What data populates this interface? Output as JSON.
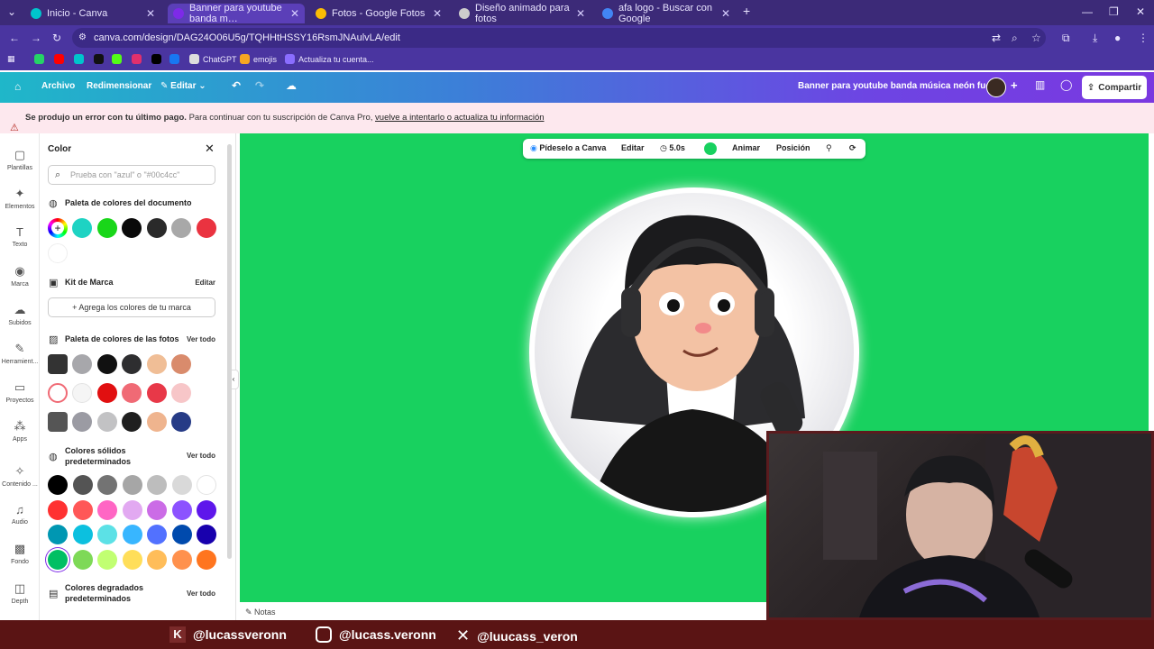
{
  "browser": {
    "tabs": [
      {
        "title": "Inicio - Canva",
        "color": "#00c4cc"
      },
      {
        "title": "Banner para youtube banda m…",
        "color": "#7d2ae8"
      },
      {
        "title": "Fotos - Google Fotos",
        "color": "#fbbc04"
      },
      {
        "title": "Diseño animado para fotos",
        "color": "#cccccc"
      },
      {
        "title": "afa logo - Buscar con Google",
        "color": "#4285f4"
      }
    ],
    "url": "canva.com/design/DAG24O06U5g/TQHHtHSSY16RsmJNAulvLA/edit",
    "bookmarks": [
      "ChatGPT",
      "emojis",
      "Actualiza tu cuenta..."
    ]
  },
  "header": {
    "file": "Archivo",
    "resize": "Redimensionar",
    "edit": "Editar",
    "design_title": "Banner para youtube banda música neón fucsia",
    "share": "Compartir"
  },
  "warning": {
    "bold": "Se produjo un error con tu último pago.",
    "text": "Para continuar con tu suscripción de Canva Pro,",
    "link": "vuelve a intentarlo o actualiza tu información"
  },
  "rail": [
    "Plantillas",
    "Elementos",
    "Texto",
    "Marca",
    "Subidos",
    "Herramient...",
    "Proyectos",
    "Apps",
    "Contenido ...",
    "Audio",
    "Fondo",
    "Depth"
  ],
  "panel": {
    "title": "Color",
    "search_placeholder": "Prueba con \"azul\" o \"#00c4cc\"",
    "doc_palette": "Paleta de colores del documento",
    "doc_colors": [
      "#1ed3c3",
      "#19d619",
      "#0a0a0a",
      "#2a2a2a",
      "#a8a8a8",
      "#ea3340"
    ],
    "brand_kit": "Kit de Marca",
    "brand_edit": "Editar",
    "add_brand": "Agrega los colores de tu marca",
    "photo_palette": "Paleta de colores de las fotos",
    "see_all": "Ver todo",
    "photo_rows": [
      [
        "#a7a7ab",
        "#111111",
        "#2e2e30",
        "#f0be96",
        "#d98b6c"
      ],
      [
        "#f5f5f5",
        "#e10f10",
        "#f06a75",
        "#e83848",
        "#f7c6c8"
      ],
      [
        "#9b9ba3",
        "#c2c2c4",
        "#1f1f1f",
        "#efb48e",
        "#263b86"
      ]
    ],
    "solid": "Colores sólidos predeterminados",
    "solid_rows": [
      [
        "#000000",
        "#545454",
        "#737373",
        "#a6a6a6",
        "#bdbdbd",
        "#d9d9d9",
        "#ffffff"
      ],
      [
        "#ff3131",
        "#ff5757",
        "#ff66c4",
        "#e2a9f1",
        "#cb6ce6",
        "#8c52ff",
        "#5e17eb"
      ],
      [
        "#0097b2",
        "#0cc0df",
        "#5ce1e6",
        "#38b6ff",
        "#5271ff",
        "#004aad",
        "#1800ad"
      ],
      [
        "#00bf63",
        "#7ed957",
        "#c1ff72",
        "#ffde59",
        "#ffbd59",
        "#ff914d",
        "#ff751f"
      ]
    ],
    "gradient": "Colores degradados predeterminados"
  },
  "canvas": {
    "bg": "#18d15f",
    "toolbar": [
      "Pídeselo a Canva",
      "Editar",
      "5.0s",
      "Animar",
      "Posición"
    ],
    "notes": "Notas"
  },
  "footer": {
    "socials": [
      "@lucassveronn",
      "@lucass.veronn",
      "@luucass_veron"
    ]
  }
}
